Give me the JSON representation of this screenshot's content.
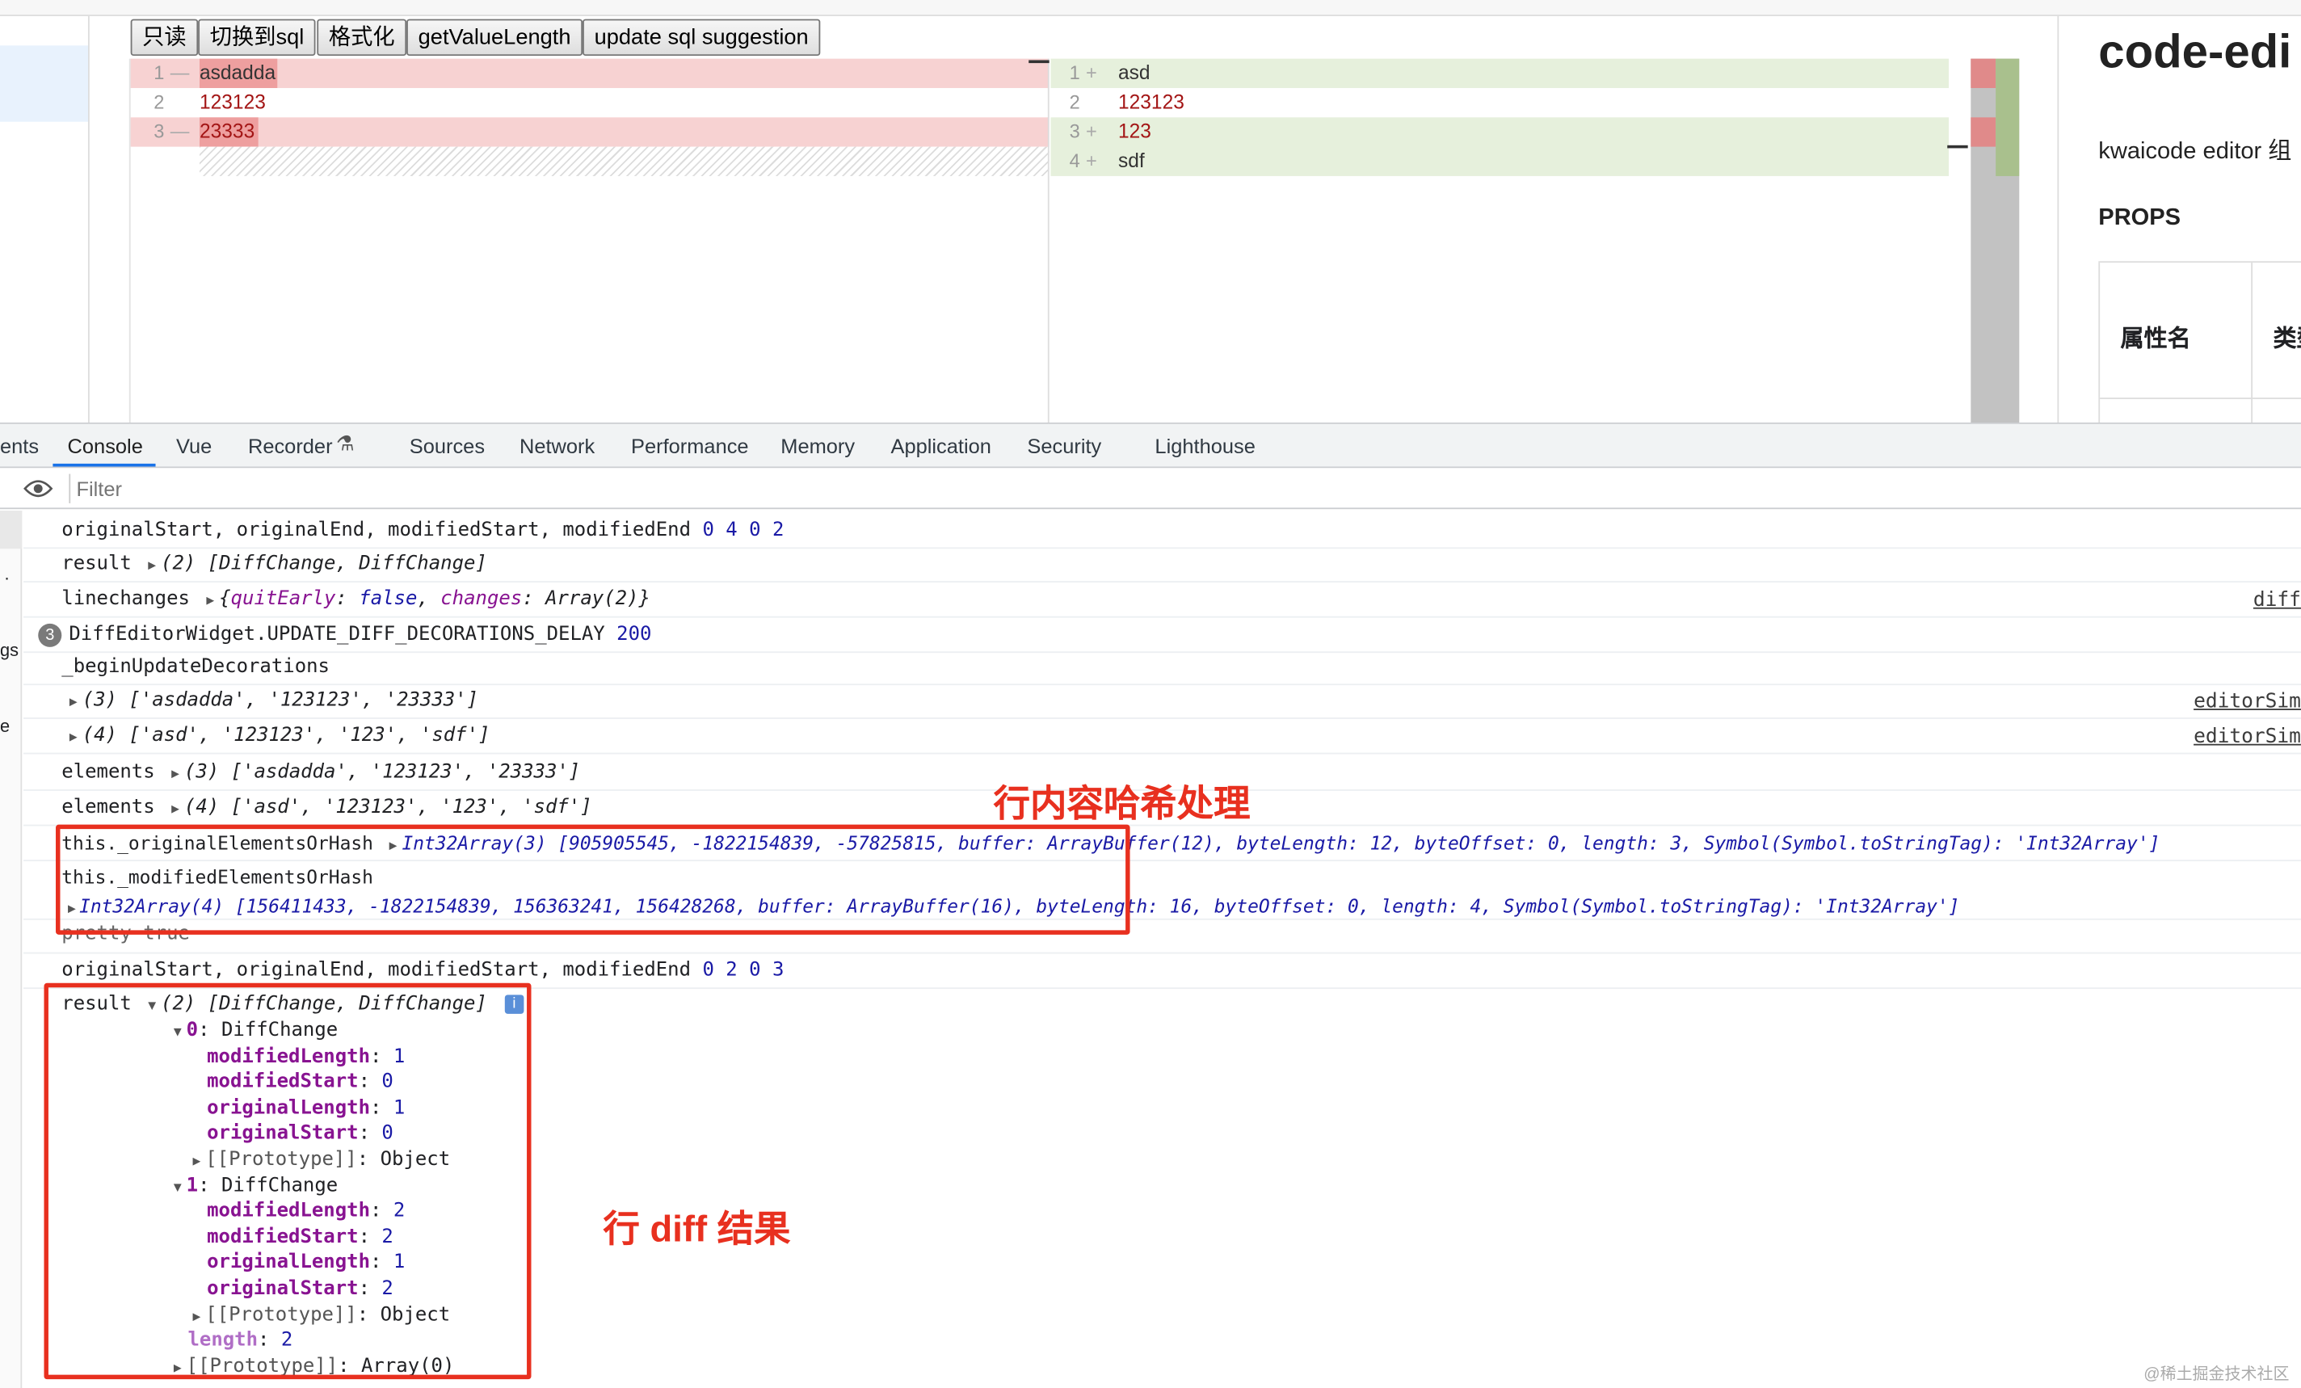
{
  "toolbar": {
    "btn_readonly": "只读",
    "btn_switch_sql": "切换到sql",
    "btn_format": "格式化",
    "btn_value_length": "getValueLength",
    "btn_update_sql": "update sql suggestion"
  },
  "diff_editor": {
    "original": [
      {
        "num": "1",
        "marker": "—",
        "text": "asdadda"
      },
      {
        "num": "2",
        "marker": "",
        "text": "123123"
      },
      {
        "num": "3",
        "marker": "—",
        "text": "23333"
      }
    ],
    "modified": [
      {
        "num": "1",
        "marker": "+",
        "text": "asd"
      },
      {
        "num": "2",
        "marker": "",
        "text": "123123"
      },
      {
        "num": "3",
        "marker": "+",
        "text": "123"
      },
      {
        "num": "4",
        "marker": "+",
        "text": "sdf"
      }
    ]
  },
  "docs": {
    "title": "code-edi",
    "desc": "kwaicode editor 组",
    "props_heading": "PROPS",
    "col_name": "属性名",
    "col_type": "类型"
  },
  "devtools": {
    "tabs": [
      "ents",
      "Console",
      "Vue",
      "Recorder",
      "Sources",
      "Network",
      "Performance",
      "Memory",
      "Application",
      "Security",
      "Lighthouse"
    ],
    "filter_placeholder": "Filter",
    "side_labels": [
      "..",
      ".",
      "gs",
      "e"
    ]
  },
  "console": {
    "l1": "originalStart, originalEnd, modifiedStart, modifiedEnd",
    "l1_vals": "0 4 0 2",
    "l2_prefix": "result",
    "l2_val": "(2) [DiffChange, DiffChange]",
    "l3_prefix": "linechanges",
    "l3_open": "{",
    "l3_k1": "quitEarly",
    "l3_v1": "false",
    "l3_k2": "changes",
    "l3_v2": "Array(2)",
    "l3_close": "}",
    "l3_src": "diff",
    "l4_count": "3",
    "l4_text": "DiffEditorWidget.UPDATE_DIFF_DECORATIONS_DELAY",
    "l4_val": "200",
    "l5": "_beginUpdateDecorations",
    "l6_val": "(3) ['asdadda', '123123', '23333']",
    "l6_src": "editorSim",
    "l7_val": "(4) ['asd', '123123', '123', 'sdf']",
    "l7_src": "editorSim",
    "l8_prefix": "elements",
    "l8_val": "(3) ['asdadda', '123123', '23333']",
    "l9_prefix": "elements",
    "l9_val": "(4) ['asd', '123123', '123', 'sdf']",
    "l10_prefix": "this._originalElementsOrHash",
    "l10_val": "Int32Array(3) [905905545, -1822154839, -57825815, buffer: ArrayBuffer(12), byteLength: 12, byteOffset: 0, length: 3, Symbol(Symbol.toStringTag): 'Int32Array']",
    "l11_prefix": "this._modifiedElementsOrHash",
    "l11_val": "Int32Array(4) [156411433, -1822154839, 156363241, 156428268, buffer: ArrayBuffer(16), byteLength: 16, byteOffset: 0, length: 4, Symbol(Symbol.toStringTag): 'Int32Array']",
    "l12": "pretty true",
    "l13": "originalStart, originalEnd, modifiedStart, modifiedEnd",
    "l13_vals": "0 2 0 3",
    "l14_prefix": "result",
    "l14_val": "(2) [DiffChange, DiffChange]",
    "info_icon": "i",
    "tree": [
      {
        "type": "head",
        "key": "0",
        "val": "DiffChange"
      },
      {
        "type": "prop",
        "key": "modifiedLength",
        "val": "1"
      },
      {
        "type": "prop",
        "key": "modifiedStart",
        "val": "0"
      },
      {
        "type": "prop",
        "key": "originalLength",
        "val": "1"
      },
      {
        "type": "prop",
        "key": "originalStart",
        "val": "0"
      },
      {
        "type": "proto",
        "key": "[[Prototype]]",
        "val": "Object"
      },
      {
        "type": "head",
        "key": "1",
        "val": "DiffChange"
      },
      {
        "type": "prop",
        "key": "modifiedLength",
        "val": "2"
      },
      {
        "type": "prop",
        "key": "modifiedStart",
        "val": "2"
      },
      {
        "type": "prop",
        "key": "originalLength",
        "val": "1"
      },
      {
        "type": "prop",
        "key": "originalStart",
        "val": "2"
      },
      {
        "type": "proto",
        "key": "[[Prototype]]",
        "val": "Object"
      },
      {
        "type": "len",
        "key": "length",
        "val": "2"
      },
      {
        "type": "proto2",
        "key": "[[Prototype]]",
        "val": "Array(0)"
      }
    ]
  },
  "annotations": {
    "hash": "行内容哈希处理",
    "diff": "行 diff 结果"
  },
  "watermark": "@稀土掘金技术社区",
  "colors": {
    "removed_bg": "#f7d2d2",
    "added_bg": "#e6f0dc",
    "annotation_red": "#e8301f",
    "number_blue": "#1a1aa6",
    "string_red": "#c41a16",
    "key_purple": "#881391"
  }
}
